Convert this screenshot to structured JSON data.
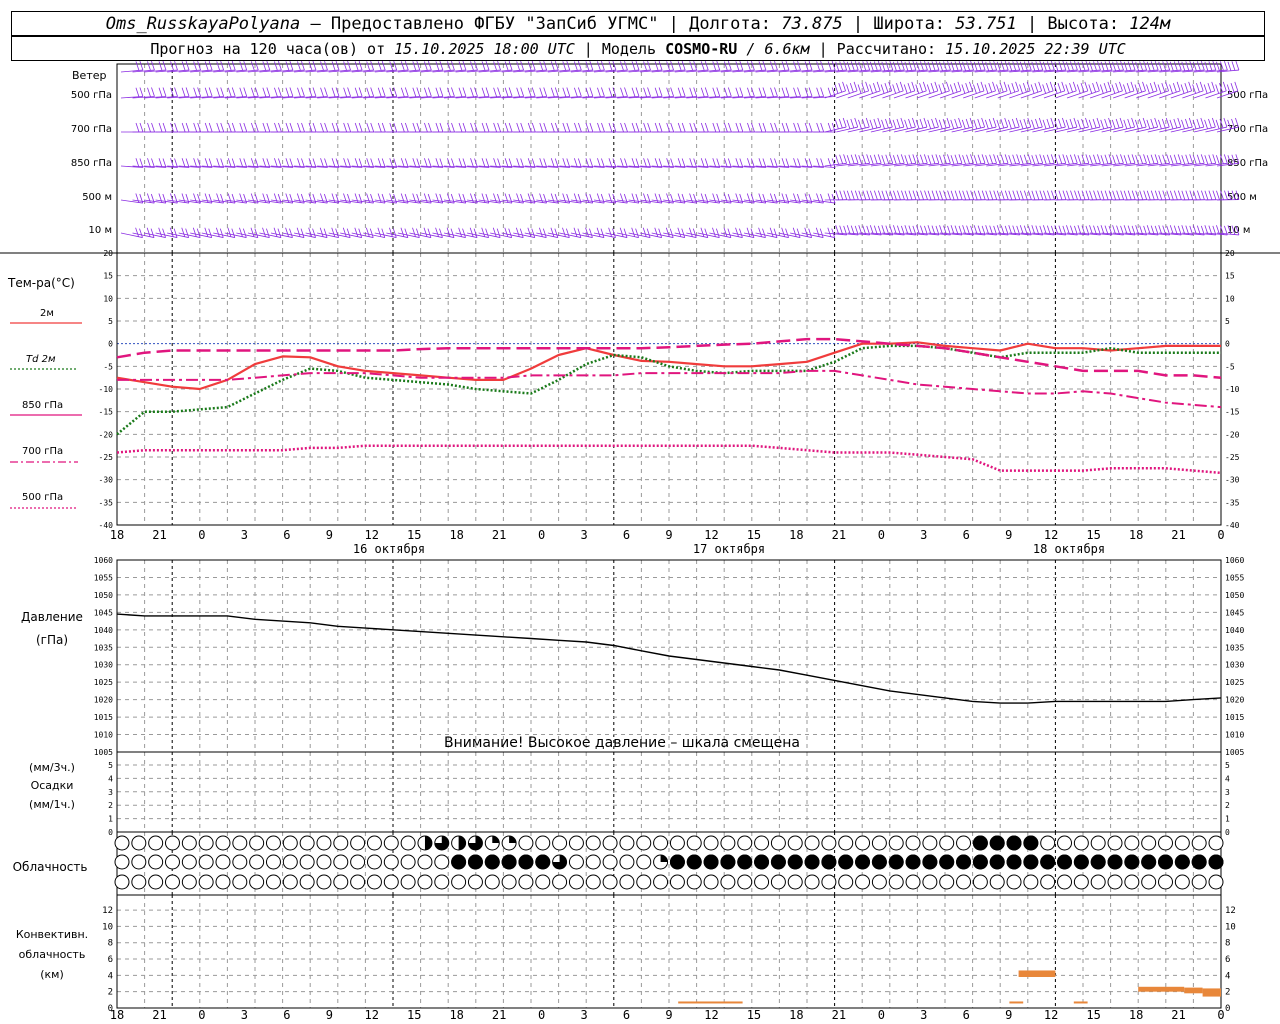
{
  "header": {
    "station": "Oms_RusskayaPolyana",
    "provider": " – Предоставлено ФГБУ \"ЗапСиб УГМС\" | Долгота: ",
    "lon": "73.875",
    "lat_label": " | Широта: ",
    "lat": "53.751",
    "alt_label": " | Высота: ",
    "alt": "124м",
    "forecast_prefix": "Прогноз на 120 часа(ов) от ",
    "forecast_start": "15.10.2025 18:00 UTC",
    "model_label": " | Модель ",
    "model": "COSMO-RU",
    "resolution": " / 6.6км",
    "calc_label": " | Рассчитано: ",
    "calc_time": "15.10.2025 22:39 UTC"
  },
  "colors": {
    "grid": "#9a9a9a",
    "wind": "#8a2be2",
    "t2m": "#f03c3c",
    "td2m": "#1a7a1a",
    "t850": "#e0157e",
    "t700": "#e0157e",
    "t500": "#e0157e",
    "pressure": "#000000",
    "convective": "#e8873a"
  },
  "time_axis": {
    "ticks": [
      "18",
      "21",
      "0",
      "3",
      "6",
      "9",
      "12",
      "15",
      "18",
      "21",
      "0",
      "3",
      "6",
      "9",
      "12",
      "15",
      "18",
      "21",
      "0",
      "3",
      "6",
      "9",
      "12",
      "15",
      "18",
      "21",
      "0"
    ],
    "dates": [
      "16 октября",
      "17 октября",
      "18 октября"
    ]
  },
  "wind_panel": {
    "title": "Ветер",
    "levels": [
      "500 гПа",
      "700 гПа",
      "850 гПа",
      "500 м",
      "10  м"
    ]
  },
  "temp_panel": {
    "title": "Тем-ра(°C)",
    "legend": [
      {
        "label": "2м",
        "style": "solid"
      },
      {
        "label": "Td 2м",
        "style": "dotted"
      },
      {
        "label": "850 гПа",
        "style": "solid"
      },
      {
        "label": "700 гПа",
        "style": "dashdot"
      },
      {
        "label": "500 гПа",
        "style": "dotted"
      }
    ],
    "yticks": [
      "20",
      "15",
      "10",
      "5",
      "0",
      "-5",
      "-10",
      "-15",
      "-20",
      "-25",
      "-30",
      "-35",
      "-40"
    ]
  },
  "pressure_panel": {
    "title1": "Давление",
    "title2": "(гПа)",
    "yticks": [
      "1060",
      "1055",
      "1050",
      "1045",
      "1040",
      "1035",
      "1030",
      "1025",
      "1020",
      "1015",
      "1010",
      "1005"
    ],
    "warning": "Внимание! Высокое давление – шкала смещена"
  },
  "precip_panel": {
    "label1": "(мм/3ч.)",
    "label2": "Осадки",
    "label3": "(мм/1ч.)",
    "yticks": [
      "5",
      "4",
      "3",
      "2",
      "1",
      "0"
    ]
  },
  "cloud_panel": {
    "title": "Облачность",
    "rows": [
      [
        0,
        0,
        0,
        0,
        0,
        0,
        0,
        0,
        0,
        0,
        0,
        0,
        0,
        0,
        0,
        0,
        0,
        0,
        0,
        0,
        0,
        0,
        0,
        0,
        0,
        0,
        0,
        0,
        0,
        0,
        0,
        0,
        0,
        0,
        0,
        0,
        0,
        0,
        0,
        0,
        0,
        0,
        0,
        0,
        0,
        0,
        0,
        0,
        0,
        2,
        2,
        2,
        2,
        3,
        3,
        3,
        3,
        2,
        2,
        2,
        3,
        3,
        1,
        1,
        2,
        1,
        0,
        0,
        0,
        0,
        0,
        0,
        0,
        0,
        0,
        0,
        0,
        0,
        0,
        0,
        0,
        0,
        0,
        0,
        0,
        0,
        0,
        0,
        0,
        0,
        0,
        0,
        0,
        0,
        0,
        0,
        0,
        0,
        0,
        0,
        0,
        0,
        0,
        0,
        0,
        0,
        0,
        0,
        0,
        0,
        0,
        0,
        0,
        0,
        0,
        0,
        0,
        0,
        0,
        0,
        0,
        4,
        4,
        0,
        0,
        0,
        0,
        0,
        0,
        0,
        0,
        0,
        0,
        0,
        0,
        0,
        0,
        0,
        0,
        0,
        0,
        0,
        0,
        0,
        4,
        4,
        4,
        4,
        4,
        4,
        4,
        4,
        4,
        4,
        4,
        0,
        0,
        0,
        0,
        0,
        0,
        0,
        0,
        0,
        0,
        0,
        0,
        0,
        0,
        0,
        0,
        0,
        0,
        0,
        0,
        0,
        0,
        0,
        0,
        0,
        0,
        0,
        0,
        0,
        0,
        0,
        0,
        0,
        0
      ],
      [
        0,
        0,
        0,
        0,
        0,
        0,
        0,
        0,
        0,
        0,
        0,
        0,
        0,
        0,
        0,
        0,
        0,
        0,
        0,
        0,
        0,
        0,
        0,
        0,
        0,
        0,
        0,
        0,
        0,
        0,
        0,
        0,
        0,
        0,
        0,
        0,
        0,
        0,
        0,
        0,
        0,
        0,
        0,
        0,
        0,
        0,
        0,
        0,
        0,
        0,
        0,
        0,
        0,
        4,
        4,
        4,
        4,
        4,
        4,
        4,
        4,
        4,
        4,
        4,
        4,
        4,
        4,
        4,
        4,
        3,
        2,
        0,
        0,
        0,
        0,
        0,
        0,
        0,
        0,
        0,
        0,
        0,
        0,
        0,
        0,
        1,
        3,
        4,
        4,
        4,
        4,
        4,
        4,
        4,
        4,
        4,
        4,
        4,
        4,
        4,
        4,
        4,
        4,
        4,
        4,
        4,
        4,
        4,
        4,
        4,
        4,
        4,
        4,
        4,
        4,
        4,
        4,
        4,
        4,
        4,
        4,
        4,
        4,
        4,
        4,
        4,
        4,
        4,
        4,
        4,
        4,
        4,
        4,
        4,
        4,
        4,
        4,
        4,
        4,
        4,
        4,
        4,
        4,
        4,
        4,
        4,
        4,
        4,
        4,
        4,
        4,
        4,
        4,
        4,
        4,
        4,
        4,
        4,
        4,
        4,
        4,
        4,
        4,
        4,
        4,
        4,
        4,
        4,
        4,
        4,
        4,
        4,
        4,
        4,
        4,
        4,
        4
      ],
      [
        0,
        0,
        0,
        0,
        0,
        0,
        0,
        0,
        0,
        0,
        0,
        0,
        0,
        0,
        0,
        0,
        0,
        0,
        0,
        0,
        0,
        0,
        0,
        0,
        0,
        0,
        0,
        0,
        0,
        0,
        0,
        0,
        0,
        0,
        0,
        0,
        0,
        0,
        0,
        0,
        0,
        0,
        0,
        0,
        0,
        0,
        0,
        0,
        0,
        0,
        0,
        0,
        0,
        0,
        0,
        0,
        0,
        0,
        0,
        0,
        0,
        0,
        0,
        0,
        0,
        0,
        0,
        0,
        0,
        0,
        0,
        0,
        0,
        0,
        0,
        0,
        0,
        0,
        0,
        0,
        0,
        0,
        0,
        0,
        0,
        0,
        0,
        0,
        0,
        0,
        0,
        0,
        0,
        0,
        0,
        0,
        0,
        0,
        0,
        0,
        0,
        0,
        0,
        0,
        0,
        0,
        0,
        0,
        0,
        0,
        0,
        0,
        0,
        0,
        0,
        0,
        0,
        0,
        0,
        0,
        0,
        0,
        0,
        0,
        0,
        0,
        0,
        0,
        0,
        0,
        0,
        0,
        0,
        0,
        0,
        0,
        0,
        0,
        0,
        0,
        0,
        0,
        0,
        0,
        0,
        0,
        0,
        0,
        0,
        0,
        0,
        0,
        0,
        0,
        0,
        0,
        0,
        0,
        0,
        0,
        0,
        0,
        0,
        0,
        0,
        0,
        0,
        0,
        0,
        0,
        0,
        0,
        0,
        0,
        0,
        0,
        0,
        0,
        0,
        0,
        0,
        0,
        0,
        0,
        0,
        0,
        0,
        0,
        0
      ]
    ]
  },
  "conv_panel": {
    "title1": "Конвективн.",
    "title2": "облачность",
    "title3": "(км)",
    "yticks": [
      "12",
      "10",
      "8",
      "6",
      "4",
      "2",
      "0"
    ]
  },
  "chart_data": [
    {
      "type": "line",
      "title": "Тем-ра(°C)",
      "ylim": [
        -40,
        20
      ],
      "x_hours": [
        0,
        3,
        6,
        9,
        12,
        15,
        18,
        21,
        24,
        27,
        30,
        33,
        36,
        39,
        42,
        45,
        48,
        51,
        54,
        57,
        60,
        63,
        66,
        69,
        72,
        75,
        78,
        81,
        84,
        87,
        90,
        93,
        96,
        99,
        102,
        105,
        108,
        111,
        114,
        117,
        120
      ],
      "series": [
        {
          "name": "2м",
          "values": [
            -7.5,
            -8.5,
            -9.5,
            -10,
            -8,
            -4.5,
            -2.8,
            -3,
            -5,
            -6,
            -6.5,
            -7,
            -7.5,
            -8,
            -8,
            -5.5,
            -2.5,
            -1,
            -2.5,
            -3.8,
            -4,
            -4.5,
            -5,
            -5,
            -4.5,
            -4,
            -2,
            0,
            0,
            0.3,
            -0.5,
            -1,
            -1.5,
            0,
            -1,
            -1,
            -1.5,
            -1,
            -0.5,
            -0.5,
            -0.5
          ]
        },
        {
          "name": "Td 2м",
          "values": [
            -20,
            -15,
            -15,
            -14.5,
            -14,
            -11,
            -8,
            -5.5,
            -6,
            -7.5,
            -8,
            -8.5,
            -9,
            -10,
            -10.5,
            -11,
            -8,
            -4.5,
            -2.5,
            -3,
            -5,
            -6,
            -6.5,
            -6,
            -6,
            -6,
            -4,
            -1,
            -0.5,
            -0.5,
            -1,
            -2,
            -3,
            -2,
            -2,
            -2,
            -1,
            -2,
            -2,
            -2,
            -2
          ]
        },
        {
          "name": "850 гПа",
          "values": [
            -3,
            -2,
            -1.5,
            -1.5,
            -1.5,
            -1.5,
            -1.5,
            -1.5,
            -1.5,
            -1.5,
            -1.5,
            -1.2,
            -1,
            -1,
            -1,
            -1,
            -1,
            -1,
            -1,
            -1,
            -0.8,
            -0.5,
            -0.2,
            0,
            0.5,
            1,
            1,
            0.5,
            0,
            -0.5,
            -1,
            -2,
            -3,
            -4,
            -5,
            -6,
            -6,
            -6,
            -7,
            -7,
            -7.5
          ]
        },
        {
          "name": "700 гПа",
          "values": [
            -8,
            -8,
            -8,
            -8,
            -8,
            -7.5,
            -7,
            -6.5,
            -6.5,
            -6.5,
            -7,
            -7.5,
            -7.5,
            -7.5,
            -7.5,
            -7,
            -7,
            -7,
            -7,
            -6.5,
            -6.5,
            -6.5,
            -6.5,
            -6.5,
            -6.5,
            -6,
            -6,
            -7,
            -8,
            -9,
            -9.5,
            -10,
            -10.5,
            -11,
            -11,
            -10.5,
            -11,
            -12,
            -13,
            -13.5,
            -14
          ]
        },
        {
          "name": "500 гПа",
          "values": [
            -24,
            -23.5,
            -23.5,
            -23.5,
            -23.5,
            -23.5,
            -23.5,
            -23,
            -23,
            -22.5,
            -22.5,
            -22.5,
            -22.5,
            -22.5,
            -22.5,
            -22.5,
            -22.5,
            -22.5,
            -22.5,
            -22.5,
            -22.5,
            -22.5,
            -22.5,
            -22.5,
            -23,
            -23.5,
            -24,
            -24,
            -24,
            -24.5,
            -25,
            -25.5,
            -28,
            -28,
            -28,
            -28,
            -27.5,
            -27.5,
            -27.5,
            -28,
            -28.5
          ]
        }
      ]
    },
    {
      "type": "line",
      "title": "Давление (гПа)",
      "ylim": [
        1005,
        1060
      ],
      "x_hours": [
        0,
        3,
        6,
        9,
        12,
        15,
        18,
        21,
        24,
        27,
        30,
        33,
        36,
        39,
        42,
        45,
        48,
        51,
        54,
        57,
        60,
        63,
        66,
        69,
        72,
        75,
        78,
        81,
        84,
        87,
        90,
        93,
        96,
        99,
        102,
        105,
        108,
        111,
        114,
        117,
        120
      ],
      "series": [
        {
          "name": "Давление",
          "values": [
            1044.5,
            1044,
            1044,
            1044,
            1044,
            1043,
            1042.5,
            1042,
            1041,
            1040.5,
            1040,
            1039.5,
            1039,
            1038.5,
            1038,
            1037.5,
            1037,
            1036.5,
            1035.5,
            1034,
            1032.5,
            1031.5,
            1030.5,
            1029.5,
            1028.5,
            1027,
            1025.5,
            1024,
            1022.5,
            1021.5,
            1020.5,
            1019.5,
            1019,
            1019,
            1019.5,
            1019.5,
            1019.5,
            1019.5,
            1019.5,
            1020,
            1020.5
          ]
        }
      ]
    },
    {
      "type": "bar",
      "title": "Конвективн. облачность (км)",
      "ylim": [
        0,
        13
      ],
      "segments": [
        {
          "h0": 61,
          "h1": 68,
          "base": 0.6,
          "top": 0.8
        },
        {
          "h0": 97,
          "h1": 98.5,
          "base": 0.6,
          "top": 0.8
        },
        {
          "h0": 98,
          "h1": 102,
          "base": 3.8,
          "top": 4.6
        },
        {
          "h0": 104,
          "h1": 105.5,
          "base": 0.6,
          "top": 0.8
        },
        {
          "h0": 111,
          "h1": 116,
          "base": 2.0,
          "top": 2.6
        },
        {
          "h0": 116,
          "h1": 118,
          "base": 1.8,
          "top": 2.5
        },
        {
          "h0": 118,
          "h1": 120,
          "base": 1.4,
          "top": 2.4
        }
      ]
    }
  ]
}
